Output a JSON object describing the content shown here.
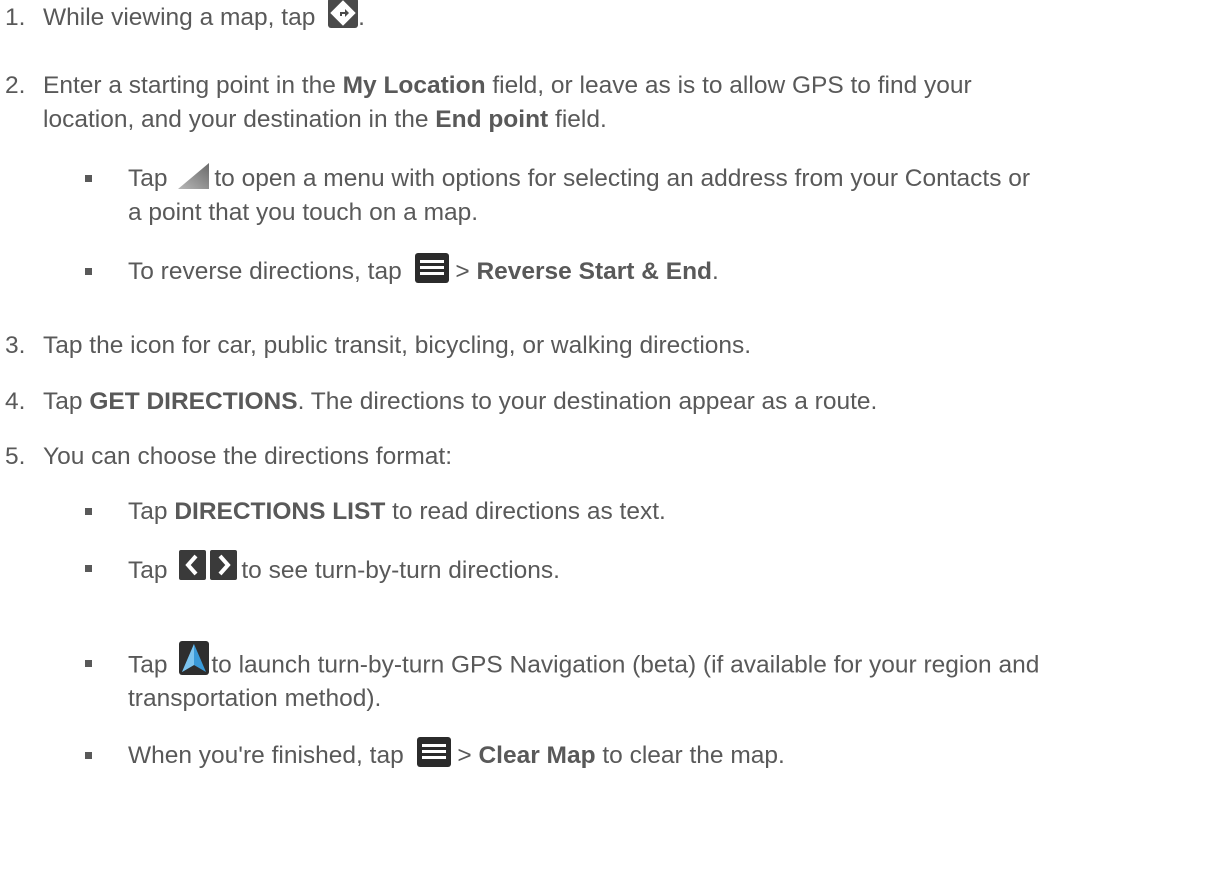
{
  "steps": [
    {
      "number": "1.",
      "lines": [
        {
          "before": "While viewing a map, tap",
          "after": "."
        }
      ]
    },
    {
      "number": "2.",
      "lines": [
        {
          "before": "Enter a starting point in the ",
          "bold1": "My Location",
          "mid": " field, or leave as is to allow GPS to find your"
        },
        {
          "before": "location, and your destination in the ",
          "bold1": "End point",
          "mid": " field."
        }
      ],
      "bullets": [
        {
          "lines": [
            {
              "before": "Tap",
              "after": "to open a menu with options for selecting an address from your Contacts or"
            },
            {
              "text": "a point that you touch on a map."
            }
          ]
        },
        {
          "lines": [
            {
              "before": "To reverse directions, tap",
              "sep": " > ",
              "bold": "Reverse Start & End",
              "after": "."
            }
          ]
        }
      ]
    },
    {
      "number": "3.",
      "lines": [
        {
          "text": "Tap the icon for car, public transit, bicycling, or walking directions."
        }
      ]
    },
    {
      "number": "4.",
      "lines": [
        {
          "before": "Tap ",
          "bold": "GET DIRECTIONS",
          "after": ". The directions to your destination appear as a route."
        }
      ]
    },
    {
      "number": "5.",
      "lines": [
        {
          "text": "You can choose the directions format:"
        }
      ],
      "bullets": [
        {
          "lines": [
            {
              "before": "Tap ",
              "bold": "DIRECTIONS LIST",
              "after": " to read directions as text."
            }
          ]
        },
        {
          "lines": [
            {
              "before": "Tap",
              "after": "to see turn-by-turn directions."
            }
          ]
        },
        {
          "lines": [
            {
              "before": "Tap",
              "after": "to launch turn-by-turn GPS Navigation (beta) (if available for your region and"
            },
            {
              "text": "transportation method)."
            }
          ]
        },
        {
          "lines": [
            {
              "before": "When you're finished, tap",
              "sep": " > ",
              "bold": "Clear Map",
              "after": " to clear the map."
            }
          ]
        }
      ]
    }
  ],
  "icons": {
    "directions": "directions-icon",
    "address_picker": "address-picker-icon",
    "menu": "menu-icon",
    "prev_next": "prev-next-arrows-icon",
    "navigation": "navigation-icon"
  },
  "colors": {
    "text": "#595959",
    "icon_dark": "#3a3a3a",
    "icon_blue": "#3a9ad9"
  }
}
